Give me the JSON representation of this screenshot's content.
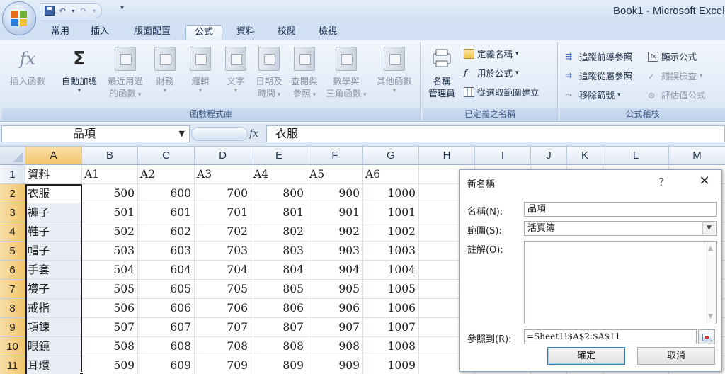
{
  "window": {
    "title": "Book1 - Microsoft Excel"
  },
  "ribbon": {
    "tabs": [
      {
        "label": "常用",
        "name": "tab-home"
      },
      {
        "label": "插入",
        "name": "tab-insert"
      },
      {
        "label": "版面配置",
        "name": "tab-page-layout"
      },
      {
        "label": "公式",
        "name": "tab-formulas",
        "active": true
      },
      {
        "label": "資料",
        "name": "tab-data"
      },
      {
        "label": "校閱",
        "name": "tab-review"
      },
      {
        "label": "檢視",
        "name": "tab-view"
      }
    ],
    "library_group": {
      "label": "函數程式庫",
      "insert_function": {
        "line1": "插入函數",
        "line2": ""
      },
      "autosum": {
        "line1": "自動加總",
        "line2": ""
      },
      "recent": {
        "line1": "最近用過",
        "line2": "的函數"
      },
      "financial": {
        "line1": "財務",
        "line2": ""
      },
      "logical": {
        "line1": "邏輯",
        "line2": ""
      },
      "text": {
        "line1": "文字",
        "line2": ""
      },
      "datetime": {
        "line1": "日期及",
        "line2": "時間"
      },
      "lookup": {
        "line1": "查閱與",
        "line2": "參照"
      },
      "math": {
        "line1": "數學與",
        "line2": "三角函數"
      },
      "more": {
        "line1": "其他函數",
        "line2": ""
      }
    },
    "names_group": {
      "label": "已定義之名稱",
      "name_manager": {
        "line1": "名稱",
        "line2": "管理員"
      },
      "define_name": "定義名稱",
      "use_in_formula": "用於公式",
      "create_from_selection": "從選取範圍建立"
    },
    "audit_group": {
      "label": "公式稽核",
      "trace_precedents": "追蹤前導參照",
      "trace_dependents": "追蹤從屬參照",
      "remove_arrows": "移除箭號",
      "show_formulas": "顯示公式",
      "error_checking": "錯誤檢查",
      "evaluate_formula": "評估值公式"
    }
  },
  "formula_bar": {
    "name_box": "品項",
    "fx": "fx",
    "content": "衣服"
  },
  "sheet": {
    "columns": [
      "A",
      "B",
      "C",
      "D",
      "E",
      "F",
      "G",
      "H",
      "I",
      "J",
      "K",
      "L",
      "M"
    ],
    "rows": [
      "1",
      "2",
      "3",
      "4",
      "5",
      "6",
      "7",
      "8",
      "9",
      "10",
      "11"
    ],
    "header_row": [
      "資料",
      "A1",
      "A2",
      "A3",
      "A4",
      "A5",
      "A6"
    ],
    "items": [
      "衣服",
      "褲子",
      "鞋子",
      "帽子",
      "手套",
      "襪子",
      "戒指",
      "項鍊",
      "眼鏡",
      "耳環"
    ],
    "values": [
      [
        500,
        600,
        700,
        800,
        900,
        1000
      ],
      [
        501,
        601,
        701,
        801,
        901,
        1001
      ],
      [
        502,
        602,
        702,
        802,
        902,
        1002
      ],
      [
        503,
        603,
        703,
        803,
        903,
        1003
      ],
      [
        504,
        604,
        704,
        804,
        904,
        1004
      ],
      [
        505,
        605,
        705,
        805,
        905,
        1005
      ],
      [
        506,
        606,
        706,
        806,
        906,
        1006
      ],
      [
        507,
        607,
        707,
        807,
        907,
        1007
      ],
      [
        508,
        608,
        708,
        808,
        908,
        1008
      ],
      [
        509,
        609,
        709,
        809,
        909,
        1009
      ]
    ]
  },
  "dialog": {
    "title": "新名稱",
    "help": "?",
    "close": "✕",
    "name_label": "名稱(N):",
    "name_value": "品項",
    "scope_label": "範圍(S):",
    "scope_value": "活頁簿",
    "comment_label": "註解(O):",
    "refers_label": "參照到(R):",
    "refers_value": "=Sheet1!$A$2:$A$11",
    "ok": "確定",
    "cancel": "取消"
  }
}
